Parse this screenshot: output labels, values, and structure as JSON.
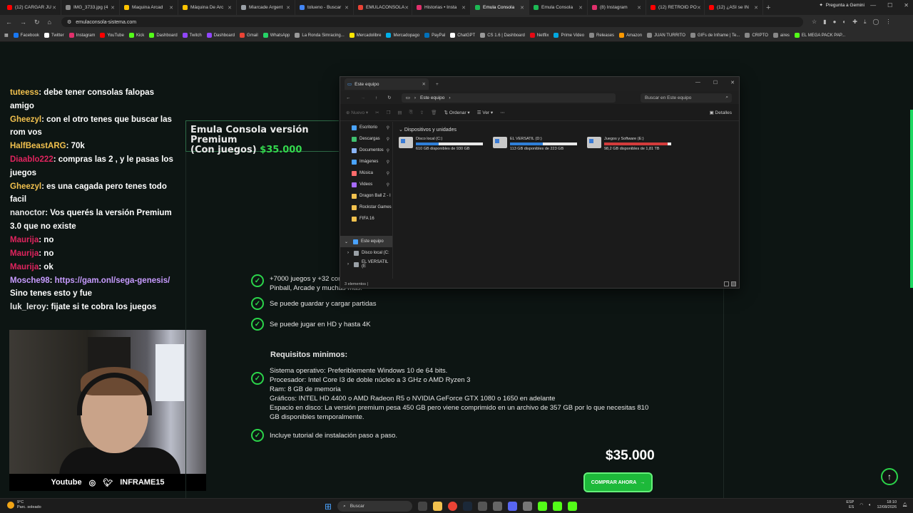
{
  "browser": {
    "tabs": [
      {
        "label": "(12) CARGAR JU",
        "color": "#ff0000",
        "active": false
      },
      {
        "label": "IMG_3733.jpg (4",
        "color": "#8a8a8a",
        "active": false
      },
      {
        "label": "Maquina Arcad",
        "color": "#ffc400",
        "active": false
      },
      {
        "label": "Máquina De Arc",
        "color": "#ffc400",
        "active": false
      },
      {
        "label": "Miarcade Argent",
        "color": "#9aa0a6",
        "active": false
      },
      {
        "label": "tolueno - Buscar",
        "color": "#4285f4",
        "active": false
      },
      {
        "label": "EMULACONSOLA",
        "color": "#ea4335",
        "active": false
      },
      {
        "label": "Historias • Insta",
        "color": "#e1306c",
        "active": false
      },
      {
        "label": "Emula Consola",
        "color": "#1db954",
        "active": true
      },
      {
        "label": "Emula Consola",
        "color": "#1db954",
        "active": false
      },
      {
        "label": "(8) Instagram",
        "color": "#e1306c",
        "active": false
      },
      {
        "label": "(12) RETROID PO",
        "color": "#ff0000",
        "active": false
      },
      {
        "label": "(12) ¿ASI se IN",
        "color": "#ff0000",
        "active": false
      }
    ],
    "gemini_label": "Pregunta a Gemini",
    "url": "emulaconsola-sistema.com",
    "bookmarks": [
      {
        "label": "Facebook",
        "color": "#1877f2"
      },
      {
        "label": "Twitter",
        "color": "#ffffff"
      },
      {
        "label": "Instagram",
        "color": "#e1306c"
      },
      {
        "label": "YouTube",
        "color": "#ff0000"
      },
      {
        "label": "Kick",
        "color": "#53fc18"
      },
      {
        "label": "Dashboard",
        "color": "#53fc18"
      },
      {
        "label": "Twitch",
        "color": "#9146ff"
      },
      {
        "label": "Dashboard",
        "color": "#9146ff"
      },
      {
        "label": "Gmail",
        "color": "#ea4335"
      },
      {
        "label": "WhatsApp",
        "color": "#25d366"
      },
      {
        "label": "La Ronda Simracing...",
        "color": "#999999"
      },
      {
        "label": "Mercadolibre",
        "color": "#ffe600"
      },
      {
        "label": "Mercadopago",
        "color": "#00b1ea"
      },
      {
        "label": "PayPal",
        "color": "#0070ba"
      },
      {
        "label": "ChatGPT",
        "color": "#ffffff"
      },
      {
        "label": "CS 1.6 | Dashboard",
        "color": "#999999"
      },
      {
        "label": "Netflix",
        "color": "#e50914"
      },
      {
        "label": "Prime Video",
        "color": "#00a8e1"
      },
      {
        "label": "Releases",
        "color": "#888888"
      },
      {
        "label": "Amazon",
        "color": "#ff9900"
      },
      {
        "label": "JUAN TURRITO",
        "color": "#888888"
      },
      {
        "label": "GIFs de Inframe | Te...",
        "color": "#888888"
      },
      {
        "label": "CRIPTO",
        "color": "#888888"
      },
      {
        "label": "aires",
        "color": "#888888"
      },
      {
        "label": "EL MEGA PACK PAP...",
        "color": "#53fc18"
      }
    ]
  },
  "chat": {
    "messages": [
      {
        "user": "tuteess",
        "color": "#f2c14e",
        "text": ": debe tener consolas falopas amigo"
      },
      {
        "user": "Gheezyl",
        "color": "#f2c14e",
        "text": ": con el otro tenes que buscar las rom vos"
      },
      {
        "user": "HalfBeastARG",
        "color": "#f2c14e",
        "text": ": 70k"
      },
      {
        "user": "Diaablo222",
        "color": "#e0245e",
        "text": ": compras las 2 , y le pasas los juegos"
      },
      {
        "user": "Gheezyl",
        "color": "#f2c14e",
        "text": ": es una cagada pero tenes todo facil"
      },
      {
        "user": "nanoctor",
        "color": "#e6e6e6",
        "text": ": Vos querés la versión Premium 3.0 que no existe"
      },
      {
        "user": "Maurija",
        "color": "#e0245e",
        "text": ": no"
      },
      {
        "user": "Maurija",
        "color": "#e0245e",
        "text": ": no"
      },
      {
        "user": "Maurija",
        "color": "#e0245e",
        "text": ": ok"
      },
      {
        "user": "Mosche98",
        "color": "#c79bff",
        "text": ": ",
        "link": "https://gam.onl/sega-genesis/",
        "after": " Sino tenes esto y fue"
      },
      {
        "user": "luk_leroy",
        "color": "#e6e6e6",
        "text": ": fijate si te cobra los juegos"
      }
    ],
    "social_youtube": "Youtube",
    "social_handle": "INFRAME15"
  },
  "product": {
    "title": "Emula Consola versión Premium",
    "title_suffix": "(Con juegos)",
    "title_price": "$35.000",
    "features": [
      "+7000 juegos y +32 consolas: Swch, Atari, Pinball, Arcade y muchas más.",
      "Se puede guardar y cargar partidas",
      "Se puede jugar en HD y hasta 4K"
    ],
    "requirements_title": "Requisitos minimos:",
    "requirements": [
      "Sistema operativo: Preferiblemente Windows 10 de 64 bits.",
      "Procesador: Intel Core I3 de doble núcleo a 3 GHz o AMD Ryzen 3",
      "Ram: 8 GB de memoria",
      "Gráficos: INTEL HD 4400 o AMD Radeon R5 o NVIDIA GeForce GTX 1080 o 1650 en adelante",
      "Espacio en disco: La versión premium pesa 450 GB pero viene comprimido en un archivo de 357 GB por lo que necesitas 810 GB disponibles temporalmente."
    ],
    "tutorial": "Incluye tutorial de instalación paso a paso.",
    "price": "$35.000",
    "buy_label": "COMPRAR AHORA"
  },
  "explorer": {
    "tab_title": "Este equipo",
    "path": "Este equipo",
    "search_placeholder": "Buscar en Este equipo",
    "cmd_new": "Nuevo",
    "cmd_sort": "Ordenar",
    "cmd_view": "Ver",
    "cmd_details": "Detalles",
    "quick_access": [
      {
        "label": "Escritorio",
        "color": "#4aa3ff",
        "pinned": true
      },
      {
        "label": "Descargas",
        "color": "#3fbf6f",
        "pinned": true
      },
      {
        "label": "Documentos",
        "color": "#8ab4f8",
        "pinned": true
      },
      {
        "label": "Imágenes",
        "color": "#4aa3ff",
        "pinned": true
      },
      {
        "label": "Música",
        "color": "#ff6b6b",
        "pinned": true
      },
      {
        "label": "Videos",
        "color": "#a86bff",
        "pinned": true
      },
      {
        "label": "Dragon Ball Z - I",
        "color": "#f2c14e",
        "pinned": false
      },
      {
        "label": "Rockstar Games",
        "color": "#f2c14e",
        "pinned": false
      },
      {
        "label": "FIFA 16",
        "color": "#f2c14e",
        "pinned": false
      }
    ],
    "tree": [
      {
        "label": "Este equipo",
        "selected": true
      },
      {
        "label": "Disco local (C:",
        "selected": false
      },
      {
        "label": "EL VERSATIL (E",
        "selected": false
      }
    ],
    "group_label": "Dispositivos y unidades",
    "drives": [
      {
        "name": "Disco local (C:)",
        "free": "610 GB disponibles de 930 GB",
        "used_fraction": 0.34,
        "color": "#2f7fd8"
      },
      {
        "name": "EL VERSATIL (D:)",
        "free": "113 GB disponibles de 223 GB",
        "used_fraction": 0.49,
        "color": "#2f7fd8"
      },
      {
        "name": "Juegos y Software (E:)",
        "free": "98,2 GB disponibles de 1,81 TB",
        "used_fraction": 0.95,
        "color": "#d23b3b"
      }
    ],
    "status": "3 elementos"
  },
  "taskbar": {
    "temp": "9°C",
    "weather": "Parc. soleado",
    "search": "Buscar",
    "lang": "ESP",
    "region": "ES",
    "time": "18:10",
    "date": "12/08/2026"
  }
}
